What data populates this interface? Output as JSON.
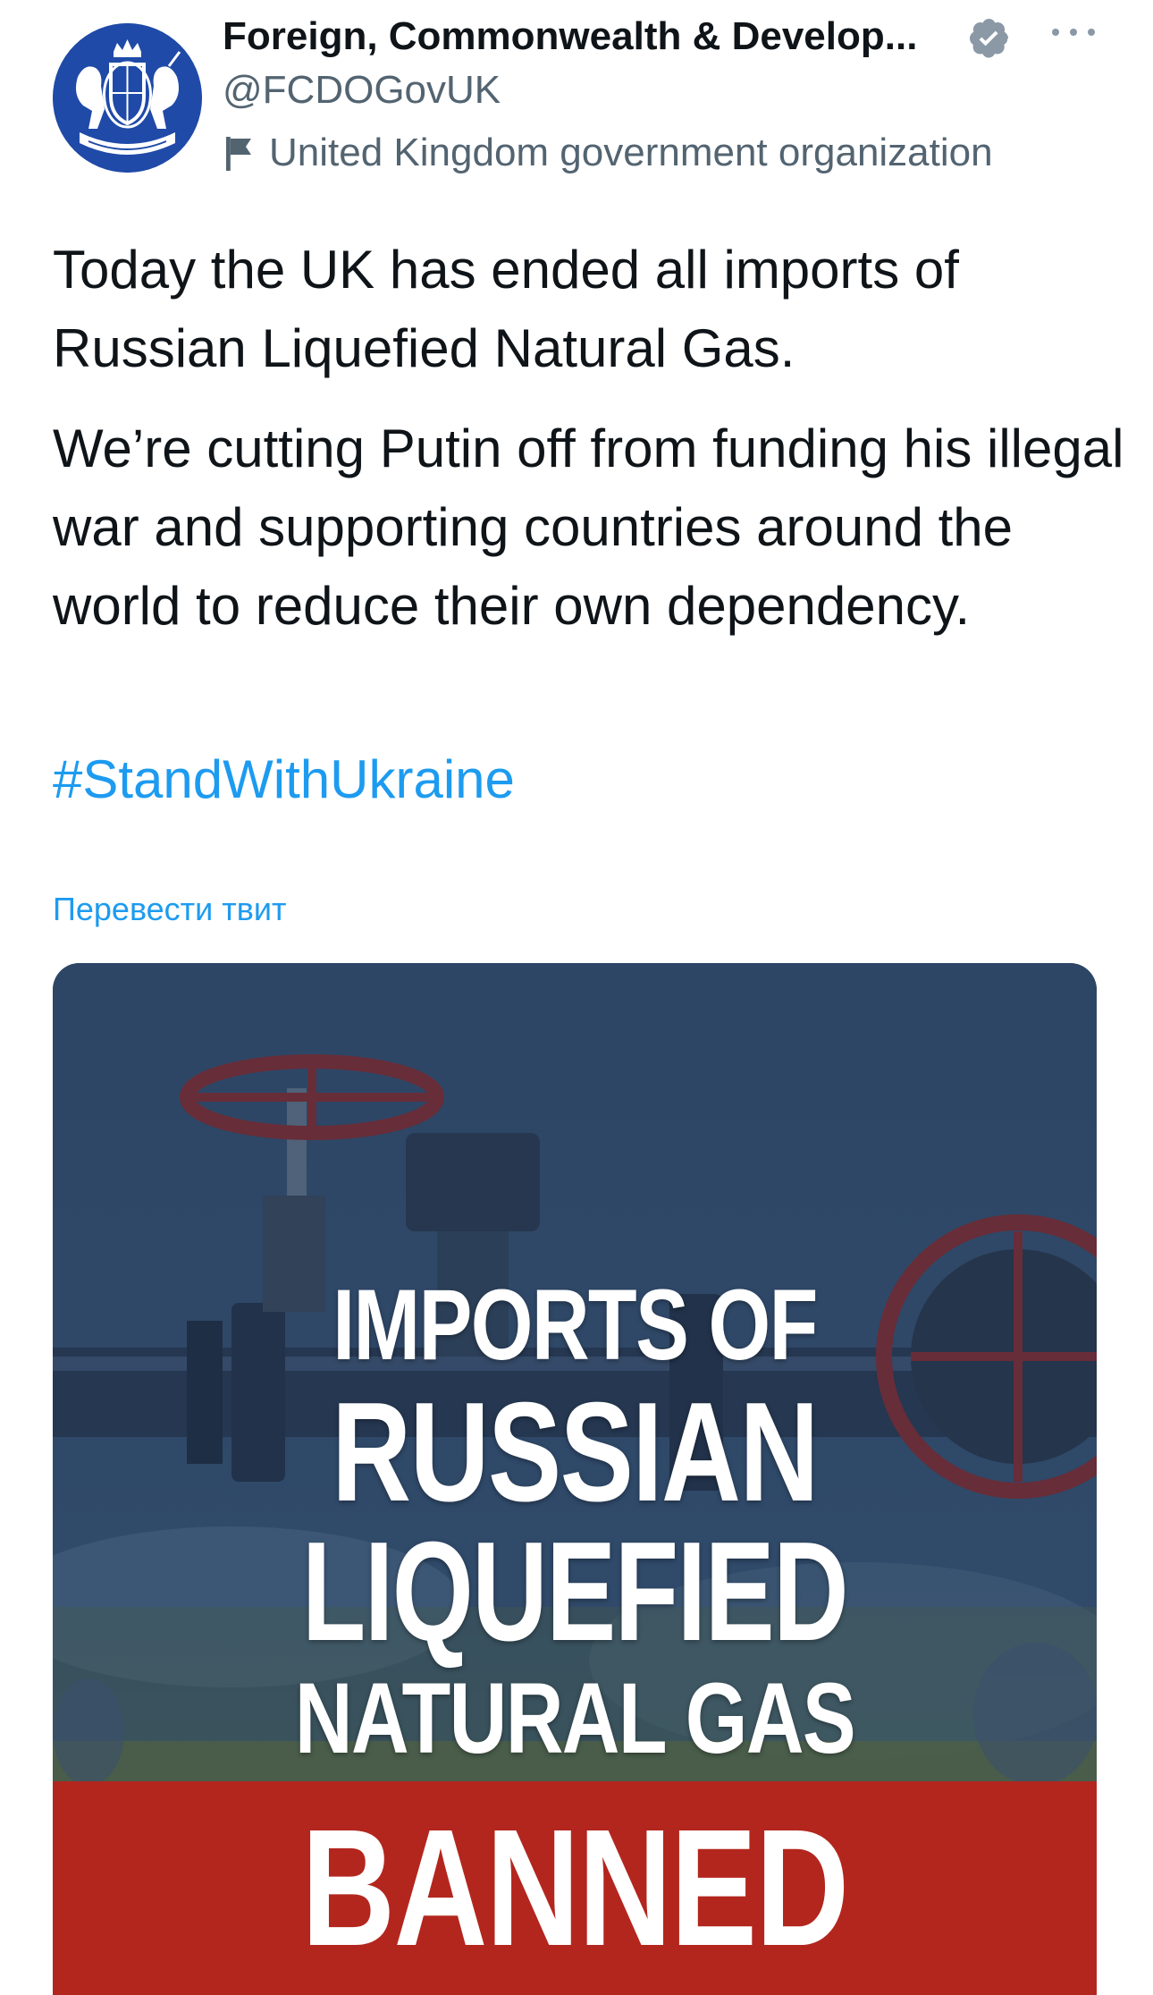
{
  "author": {
    "display_name": "Foreign, Commonwealth & Develop...",
    "handle": "@FCDOGovUK",
    "label": "United Kingdom government organization",
    "avatar_icon": "royal-coat-of-arms",
    "verified_icon": "verified-badge-icon",
    "label_icon": "flag-icon",
    "avatar_bg": "#1f4aa8"
  },
  "more_menu": {
    "icon": "more-dots-icon"
  },
  "tweet": {
    "paragraph_1": "Today the UK has ended all imports of Russian Liquefied Natural Gas.",
    "paragraph_2": "We’re cutting Putin off from funding his illegal war and supporting countries around the world to reduce their own dependency.",
    "hashtag": "#StandWithUkraine",
    "translate_link": "Перевести твит"
  },
  "media": {
    "lines": [
      "IMPORTS OF",
      "RUSSIAN",
      "LIQUEFIED",
      "NATURAL GAS"
    ],
    "banner": "BANNED",
    "banner_color": "#b3261e",
    "overlay_color": "#2f4a6c"
  },
  "colors": {
    "link": "#1d9bf0",
    "secondary_text": "#536471",
    "primary_text": "#0f1419"
  }
}
